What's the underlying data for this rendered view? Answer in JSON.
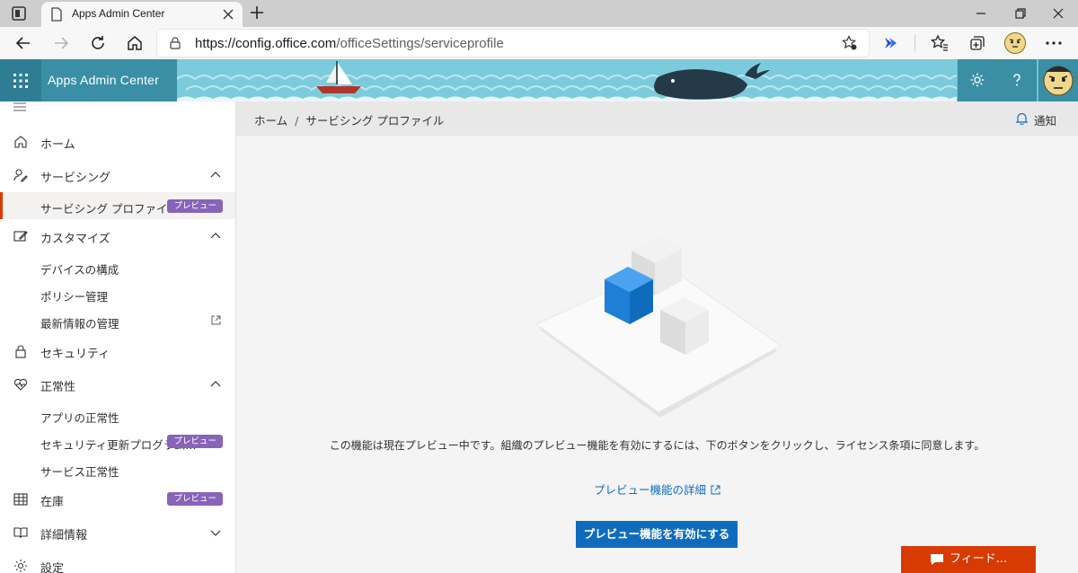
{
  "browser": {
    "tab_title": "Apps Admin Center",
    "url_domain": "https://config.office.com",
    "url_path": "/officeSettings/serviceprofile"
  },
  "header": {
    "app_title": "Apps Admin Center",
    "accent_color": "#6cc3d6",
    "icons": [
      "waffle-icon",
      "settings-icon",
      "help-icon",
      "avatar"
    ]
  },
  "sidebar": {
    "items": [
      {
        "label": "ホーム",
        "icon": "home-icon"
      },
      {
        "label": "サービシング",
        "icon": "servicing-icon",
        "expanded": true
      },
      {
        "label": "サービシング プロファイル",
        "badge": "プレビュー",
        "active": true
      },
      {
        "label": "カスタマイズ",
        "icon": "customize-icon",
        "expanded": true
      },
      {
        "label": "デバイスの構成"
      },
      {
        "label": "ポリシー管理"
      },
      {
        "label": "最新情報の管理"
      },
      {
        "label": "セキュリティ",
        "icon": "lock-icon"
      },
      {
        "label": "正常性",
        "icon": "health-icon",
        "expanded": true
      },
      {
        "label": "アプリの正常性"
      },
      {
        "label": "セキュリティ更新プログラム...",
        "badge": "プレビュー"
      },
      {
        "label": "サービス正常性"
      },
      {
        "label": "在庫",
        "icon": "inventory-icon",
        "badge": "プレビュー"
      },
      {
        "label": "詳細情報",
        "icon": "book-icon",
        "expanded": false
      },
      {
        "label": "設定",
        "icon": "settings-icon"
      }
    ]
  },
  "breadcrumb": {
    "home": "ホーム",
    "sep": "/",
    "current": "サービシング プロファイル"
  },
  "notify_label": "通知",
  "main": {
    "description": "この機能は現在プレビュー中です。組織のプレビュー機能を有効にするには、下のボタンをクリックし、ライセンス条項に同意します。",
    "more_link": "プレビュー機能の詳細",
    "enable_button": "プレビュー機能を有効にする",
    "feedback_button": "フィード..."
  }
}
